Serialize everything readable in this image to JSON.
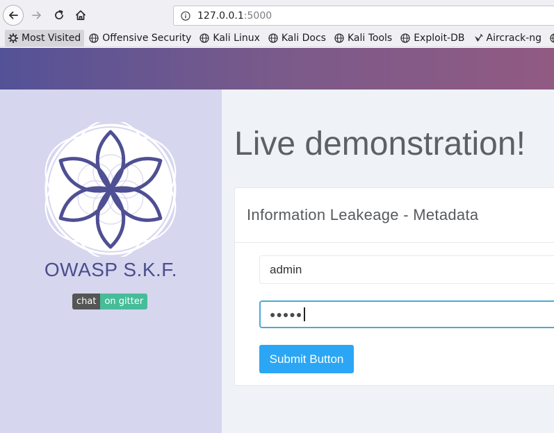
{
  "browser": {
    "url_host": "127.0.0.1",
    "url_port": ":5000",
    "bookmarks": [
      {
        "label": "Most Visited",
        "icon": "gear-icon"
      },
      {
        "label": "Offensive Security",
        "icon": "globe-icon"
      },
      {
        "label": "Kali Linux",
        "icon": "globe-icon"
      },
      {
        "label": "Kali Docs",
        "icon": "globe-icon"
      },
      {
        "label": "Kali Tools",
        "icon": "globe-icon"
      },
      {
        "label": "Exploit-DB",
        "icon": "globe-icon"
      },
      {
        "label": "Aircrack-ng",
        "icon": "satellite-icon"
      }
    ]
  },
  "sidebar": {
    "brand": "OWASP S.K.F.",
    "badge_left": "chat",
    "badge_right": "on gitter"
  },
  "main": {
    "headline": "Live demonstration!",
    "card_title": "Information Leakeage - Metadata",
    "username_value": "admin",
    "password_mask": "●●●●●",
    "submit_label": "Submit Button"
  },
  "colors": {
    "banner_start": "#545297",
    "banner_end": "#915a83",
    "sidebar_bg": "#d6d6ef",
    "brand_color": "#4b4d8c",
    "button_bg": "#2ba6f5",
    "focus_border": "#4aa9d6"
  }
}
